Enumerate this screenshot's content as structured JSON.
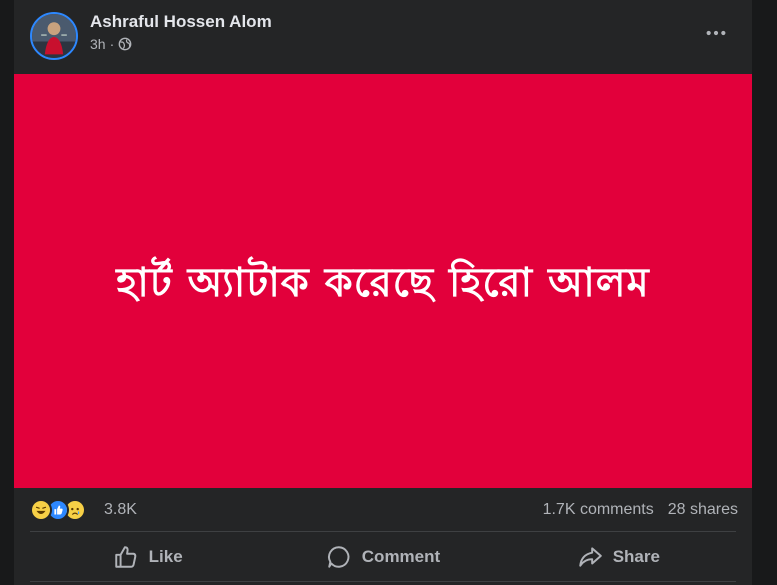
{
  "post": {
    "author": "Ashraful Hossen Alom",
    "time": "3h",
    "separator": "·",
    "audience_icon": "globe-icon",
    "image_text": "হার্ট অ্যাটাক করেছে হিরো আলম",
    "image_bg": "#e2003b"
  },
  "stats": {
    "reaction_icons": [
      "haha-icon",
      "like-icon",
      "sad-icon"
    ],
    "reaction_count": "3.8K",
    "comments": "1.7K comments",
    "shares": "28 shares"
  },
  "actions": {
    "like": "Like",
    "comment": "Comment",
    "share": "Share"
  }
}
